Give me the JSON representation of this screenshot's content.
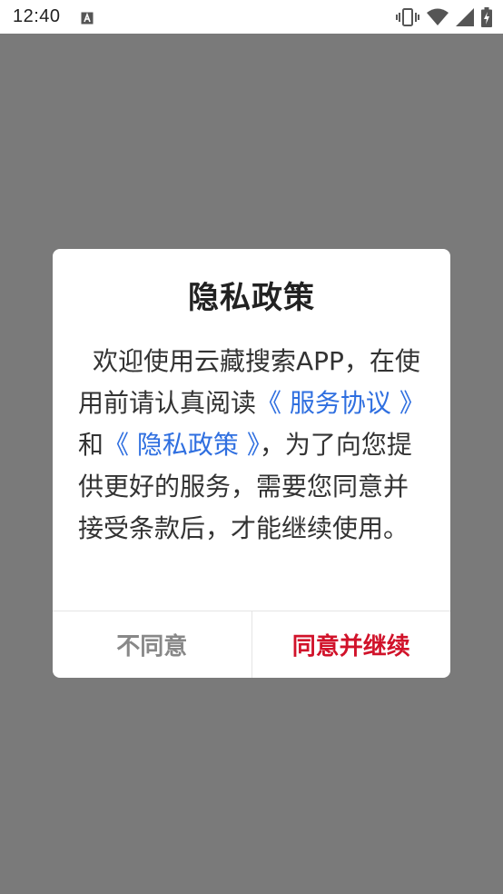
{
  "status_bar": {
    "time": "12:40",
    "icons": [
      "notification-a-icon",
      "vibrate-icon",
      "wifi-icon",
      "signal-icon",
      "battery-icon"
    ]
  },
  "dialog": {
    "title": "隐私政策",
    "body": {
      "intro": "欢迎使用云藏搜索APP，在使用前请认真阅读",
      "link1": "《 服务协议 》",
      "conj": "和",
      "link2": "《 隐私政策 》",
      "rest": "，为了向您提供更好的服务，需要您同意并接受条款后，才能继续使用。"
    },
    "decline_label": "不同意",
    "accept_label": "同意并继续"
  },
  "colors": {
    "link": "#2f6fe0",
    "accept": "#d1122a",
    "decline": "#888888",
    "overlay": "#7a7a7a"
  }
}
